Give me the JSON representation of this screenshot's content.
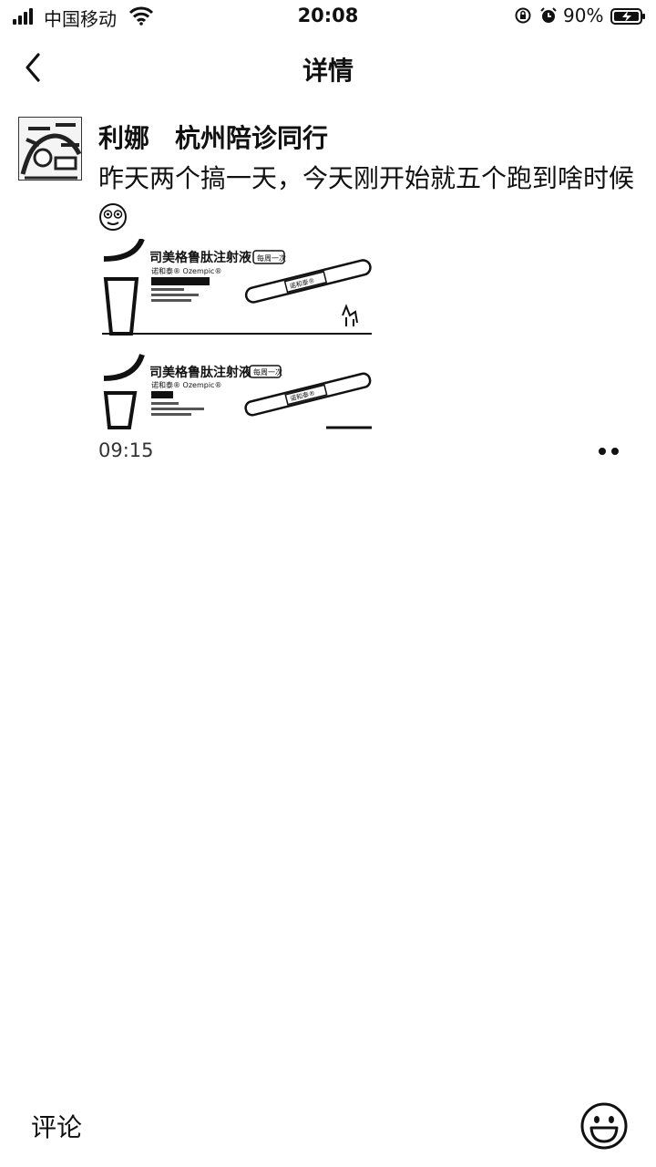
{
  "status_bar": {
    "carrier": "中国移动",
    "time": "20:08",
    "battery_percent": "90%",
    "icons": [
      "signal-icon",
      "wifi-icon",
      "orientation-lock-icon",
      "alarm-icon",
      "battery-charging-icon"
    ]
  },
  "nav": {
    "title": "详情",
    "back_icon": "chevron-left-icon"
  },
  "post": {
    "author": "利娜　杭州陪诊同行",
    "text": "昨天两个搞一天，今天刚开始就五个跑到啥时候",
    "images": [
      {
        "product_name": "司美格鲁肽注射液",
        "badge": "每周一次",
        "brand": "诺和泰® Ozempic®",
        "pen_label": "诺和泰®"
      },
      {
        "product_name": "司美格鲁肽注射液",
        "badge": "每周一次",
        "brand": "诺和泰® Ozempic®",
        "pen_label": "诺和泰®"
      }
    ],
    "time": "09:15",
    "more_icon": "more-dots-icon"
  },
  "bottom_bar": {
    "comment_label": "评论",
    "emoji_icon": "smiley-face-icon"
  },
  "colors": {
    "background": "#ffffff",
    "text": "#111111"
  }
}
